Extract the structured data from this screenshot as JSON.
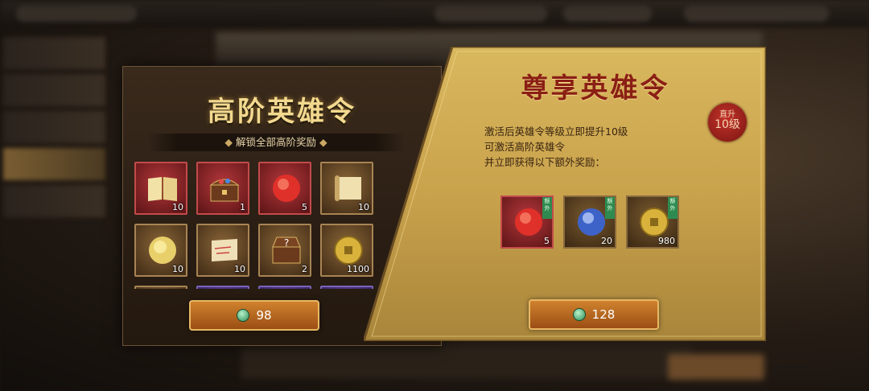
{
  "left_panel": {
    "title": "高阶英雄令",
    "subtitle": "解锁全部高阶奖励",
    "rewards": [
      {
        "icon": "book-icon",
        "count": "10",
        "rarity": "red"
      },
      {
        "icon": "treasure-chest-icon",
        "count": "1",
        "rarity": "red"
      },
      {
        "icon": "red-orb-icon",
        "count": "5",
        "rarity": "red"
      },
      {
        "icon": "scroll-icon",
        "count": "10",
        "rarity": "brown"
      },
      {
        "icon": "gold-orb-icon",
        "count": "10",
        "rarity": "brown"
      },
      {
        "icon": "map-scroll-icon",
        "count": "10",
        "rarity": "brown"
      },
      {
        "icon": "mystery-chest-icon",
        "count": "2",
        "rarity": "brown"
      },
      {
        "icon": "gold-coin-icon",
        "count": "1100",
        "rarity": "brown"
      }
    ],
    "price": "98"
  },
  "right_panel": {
    "title": "尊享英雄令",
    "seal_top": "直升",
    "seal_bottom": "10级",
    "description": [
      "激活后英雄令等级立即提升10级",
      "可激活高阶英雄令",
      "并立即获得以下额外奖励："
    ],
    "extra_tag": "额外",
    "rewards": [
      {
        "icon": "red-orb-icon",
        "count": "5"
      },
      {
        "icon": "blue-orb-icon",
        "count": "20"
      },
      {
        "icon": "gold-coin-icon",
        "count": "980"
      }
    ],
    "price": "128"
  },
  "colors": {
    "gold_title": "#f3d98f",
    "red_title": "#8a1f14",
    "button": "#c4732a",
    "jade": "#2c8a57"
  }
}
